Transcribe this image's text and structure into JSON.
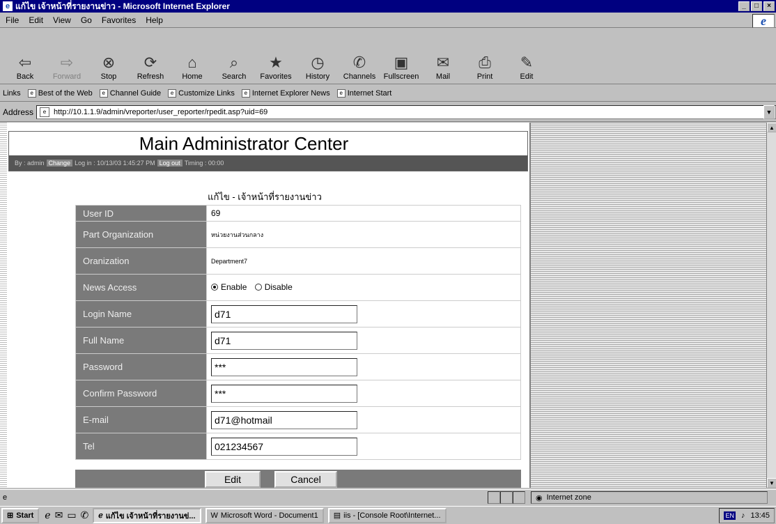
{
  "window": {
    "title": "แก้ไข เจ้าหน้าที่รายงานข่าว - Microsoft Internet Explorer",
    "controls": [
      "_",
      "□",
      "×"
    ]
  },
  "menu": [
    "File",
    "Edit",
    "View",
    "Go",
    "Favorites",
    "Help"
  ],
  "toolbar": [
    {
      "label": "Back",
      "icon": "back-arrow-icon",
      "glyph": "⇦",
      "enabled": true
    },
    {
      "label": "Forward",
      "icon": "forward-arrow-icon",
      "glyph": "⇨",
      "enabled": false
    },
    {
      "label": "Stop",
      "icon": "stop-icon",
      "glyph": "⊗",
      "enabled": true
    },
    {
      "label": "Refresh",
      "icon": "refresh-icon",
      "glyph": "⟳",
      "enabled": true
    },
    {
      "label": "Home",
      "icon": "home-icon",
      "glyph": "⌂",
      "enabled": true
    },
    {
      "label": "Search",
      "icon": "search-icon",
      "glyph": "⌕",
      "enabled": true
    },
    {
      "label": "Favorites",
      "icon": "favorites-icon",
      "glyph": "★",
      "enabled": true
    },
    {
      "label": "History",
      "icon": "history-icon",
      "glyph": "◷",
      "enabled": true
    },
    {
      "label": "Channels",
      "icon": "channels-icon",
      "glyph": "✆",
      "enabled": true
    },
    {
      "label": "Fullscreen",
      "icon": "fullscreen-icon",
      "glyph": "▣",
      "enabled": true
    },
    {
      "label": "Mail",
      "icon": "mail-icon",
      "glyph": "✉",
      "enabled": true
    },
    {
      "label": "Print",
      "icon": "print-icon",
      "glyph": "⎙",
      "enabled": true
    },
    {
      "label": "Edit",
      "icon": "edit-icon",
      "glyph": "✎",
      "enabled": true
    }
  ],
  "links": {
    "label": "Links",
    "items": [
      "Best of the Web",
      "Channel Guide",
      "Customize Links",
      "Internet Explorer News",
      "Internet Start"
    ]
  },
  "address": {
    "label": "Address",
    "url": "http://10.1.1.9/admin/vreporter/user_reporter/rpedit.asp?uid=69"
  },
  "page": {
    "banner_title": "Main Administrator Center",
    "by_text": "By : admin",
    "change_label": "Change",
    "login_text": "Log in : 10/13/03 1:45:27 PM",
    "logout_label": "Log out",
    "timing_text": "Timing : 00:00",
    "heading": "แก้ไข - เจ้าหน้าที่รายงานข่าว",
    "fields": {
      "user_id": {
        "label": "User ID",
        "value": "69"
      },
      "part_org": {
        "label": "Part Organization",
        "value": "หน่วยงานส่วนกลาง"
      },
      "organization": {
        "label": "Oranization",
        "value": "Department7"
      },
      "news_access": {
        "label": "News Access",
        "enable": "Enable",
        "disable": "Disable",
        "selected": "Enable"
      },
      "login_name": {
        "label": "Login Name",
        "value": "d71"
      },
      "full_name": {
        "label": "Full Name",
        "value": "d71"
      },
      "password": {
        "label": "Password",
        "value": "***"
      },
      "confirm_password": {
        "label": "Confirm Password",
        "value": "***"
      },
      "email": {
        "label": "E-mail",
        "value": "d71@hotmail"
      },
      "tel": {
        "label": "Tel",
        "value": "021234567"
      }
    },
    "edit_button": "Edit",
    "cancel_button": "Cancel"
  },
  "status": {
    "zone": "Internet zone"
  },
  "taskbar": {
    "start": "Start",
    "tasks": [
      "แก้ไข เจ้าหน้าที่รายงานข่...",
      "Microsoft Word - Document1",
      "iis - [Console Root\\Internet..."
    ],
    "lang": "EN",
    "clock": "13:45"
  }
}
